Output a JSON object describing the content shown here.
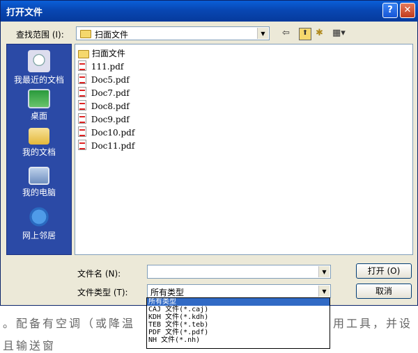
{
  "dialog": {
    "title": "打开文件",
    "help_btn": "?",
    "close_btn": "✕"
  },
  "toolbar": {
    "look_in_label": "查找范围 (I):",
    "look_in_value": "扫面文件",
    "back_icon": "⇦",
    "up_icon": "⬆",
    "new_folder_icon": "✱",
    "views_icon": "▦▾"
  },
  "places": [
    {
      "label": "我最近的文档"
    },
    {
      "label": "桌面"
    },
    {
      "label": "我的文档"
    },
    {
      "label": "我的电脑"
    },
    {
      "label": "网上邻居"
    }
  ],
  "files": [
    {
      "name": "扫面文件",
      "type": "folder"
    },
    {
      "name": "111.pdf",
      "type": "pdf"
    },
    {
      "name": "Doc5.pdf",
      "type": "pdf"
    },
    {
      "name": "Doc7.pdf",
      "type": "pdf"
    },
    {
      "name": "Doc8.pdf",
      "type": "pdf"
    },
    {
      "name": "Doc9.pdf",
      "type": "pdf"
    },
    {
      "name": "Doc10.pdf",
      "type": "pdf"
    },
    {
      "name": "Doc11.pdf",
      "type": "pdf"
    }
  ],
  "form": {
    "filename_label": "文件名 (N):",
    "filename_value": "",
    "filetype_label": "文件类型 (T):",
    "filetype_value": "所有类型",
    "open_btn": "打开 (O)",
    "cancel_btn": "取消"
  },
  "filetype_options": [
    "所有类型",
    "CAJ 文件(*.caj)",
    "KDH 文件(*.kdh)",
    "TEB 文件(*.teb)",
    "PDF 文件(*.pdf)",
    "NH 文件(*.nh)"
  ],
  "background": {
    "line1_left": "。配备有空调（或降温",
    "line1_right": "用工具，并设",
    "line2": "且输送窗"
  }
}
